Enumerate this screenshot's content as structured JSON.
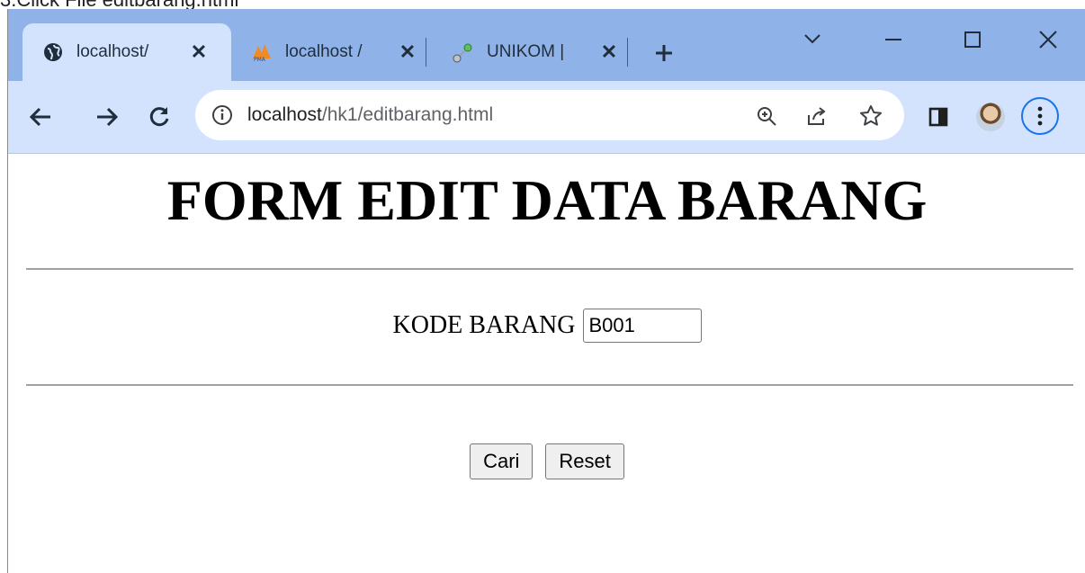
{
  "caption": "3.Click File editbarang.html",
  "browser": {
    "tabs": [
      {
        "title": "localhost/",
        "favicon": "globe-icon",
        "active": true
      },
      {
        "title": "localhost /",
        "favicon": "phpmyadmin-icon",
        "active": false
      },
      {
        "title": "UNIKOM |",
        "favicon": "unikom-icon",
        "active": false
      }
    ],
    "url": {
      "host": "localhost",
      "path": "/hk1/editbarang.html"
    }
  },
  "page": {
    "title": "FORM EDIT DATA BARANG",
    "kode_label": "KODE BARANG",
    "kode_value": "B001",
    "cari_label": "Cari",
    "reset_label": "Reset"
  },
  "colors": {
    "tabstrip": "#8fb3e8",
    "toolbar": "#d3e3fd",
    "accent": "#1a73e8"
  }
}
